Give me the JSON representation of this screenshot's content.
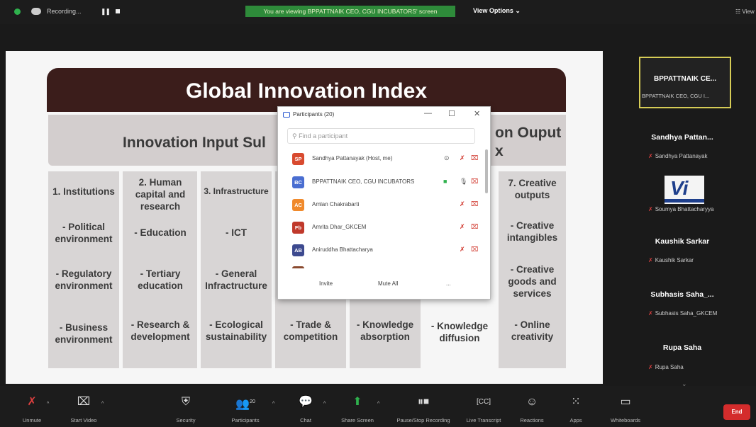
{
  "top_bar": {
    "recording_label": "Recording...",
    "banner": "You are viewing BPPATTNAIK CEO, CGU INCUBATORS' screen",
    "view_options": "View Options ⌄",
    "view_label": "View"
  },
  "slide": {
    "title": "Global Innovation Index",
    "input_subindex": "Innovation Input Sul",
    "output_subindex_line1": "on Ouput",
    "output_subindex_line2": "x",
    "columns": [
      {
        "heading": "1. Institutions",
        "items": [
          "- Political environment",
          "- Regulatory environment",
          "- Business environment"
        ]
      },
      {
        "heading": "2. Human capital and research",
        "items": [
          "- Education",
          "- Tertiary education",
          "- Research & development"
        ]
      },
      {
        "heading": "3. Infrastructure",
        "items": [
          "- ICT",
          "- General Infractructure",
          "- Ecological sustainability"
        ]
      },
      {
        "heading": "",
        "items": [
          "- Trade & competition"
        ]
      },
      {
        "heading": "",
        "items": [
          "- Knowledge absorption"
        ]
      },
      {
        "heading": "",
        "items": [
          "- Knowledge diffusion"
        ]
      },
      {
        "heading": "7. Creative outputs",
        "items": [
          "- Creative intangibles",
          "- Creative goods and services",
          "- Online creativity"
        ]
      }
    ]
  },
  "participants": {
    "title": "Participants (20)",
    "search_placeholder": "Find a participant",
    "rows": [
      {
        "initials": "SP",
        "name": "Sandhya Pattanayak (Host, me)",
        "color": "#d84a2f"
      },
      {
        "initials": "BC",
        "name": "BPPATTNAIK CEO, CGU INCUBATORS",
        "color": "#4a6ed1"
      },
      {
        "initials": "AC",
        "name": "Amlan Chakrabarti",
        "color": "#f08a2c"
      },
      {
        "initials": "Fb",
        "name": "Amrita Dhar_GKCEM",
        "color": "#c0392b"
      },
      {
        "initials": "AB",
        "name": "Aniruddha Bhattacharya",
        "color": "#3d4a8f"
      }
    ],
    "invite_label": "Invite",
    "mute_all_label": "Mute All",
    "more_label": "..."
  },
  "sidebar": {
    "active_tile": {
      "name": "BPPATTNAIK CE...",
      "sub": "BPPATTNAIK CEO, CGU I..."
    },
    "tiles": [
      {
        "name": "Sandhya Pattan...",
        "sub": "Sandhya Pattanayak"
      },
      {
        "name": "",
        "sub": "Soumya Bhattacharyya"
      },
      {
        "name": "Kaushik Sarkar",
        "sub": "Kaushik Sarkar"
      },
      {
        "name": "Subhasis Saha_...",
        "sub": "Subhasis Saha_GKCEM"
      },
      {
        "name": "Rupa Saha",
        "sub": "Rupa Saha"
      }
    ],
    "logo_text": "Vi"
  },
  "toolbar": {
    "unmute": "Unmute",
    "start_video": "Start Video",
    "security": "Security",
    "participants": "Participants",
    "participant_count": "20",
    "chat": "Chat",
    "share_screen": "Share Screen",
    "pause_recording": "Pause/Stop Recording",
    "live_transcript": "Live Transcript",
    "reactions": "Reactions",
    "apps": "Apps",
    "whiteboards": "Whiteboards",
    "end": "End"
  },
  "colors": {
    "banner_green": "#2e8b3a",
    "end_red": "#d42c2c",
    "active_tile_border": "#d6cc56",
    "slide_title_bg": "#3b1d1b"
  }
}
